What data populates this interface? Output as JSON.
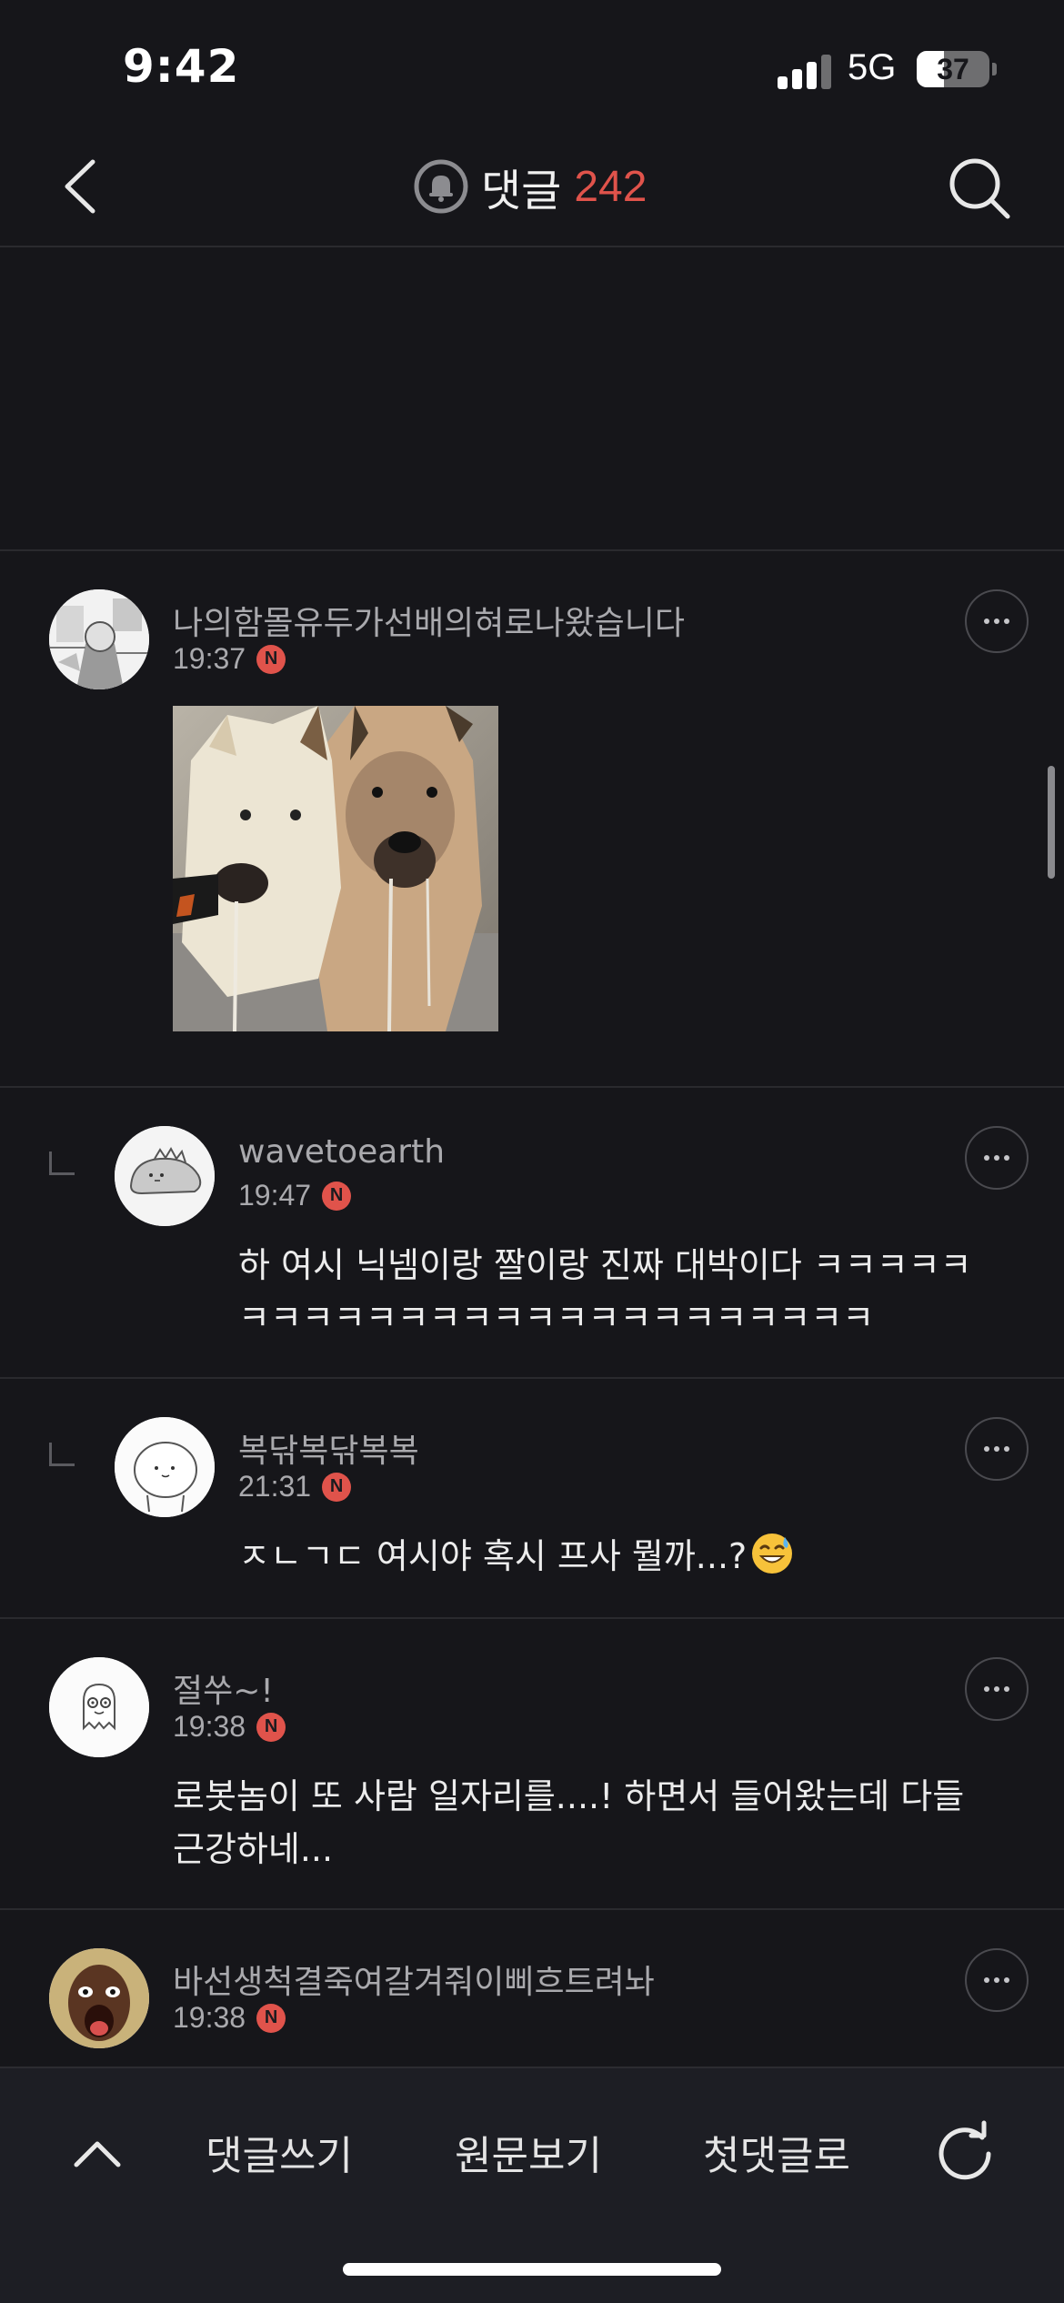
{
  "status_bar": {
    "time": "9:42",
    "network": "5G",
    "battery": "37",
    "battery_level": 0.37
  },
  "header": {
    "title": "댓글",
    "count": "242",
    "bell_icon": "bell-icon",
    "back_icon": "chevron-left-icon",
    "search_icon": "search-icon"
  },
  "comments": [
    {
      "nickname": "나의함몰유두가선배의혀로나왔습니다",
      "time": "19:37",
      "badge": "N",
      "text": "",
      "has_image": true
    },
    {
      "nickname": "wavetoearth",
      "time": "19:47",
      "badge": "N",
      "text_line1": "하 여시 닉넴이랑 짤이랑 진짜 대박이다 ㅋㅋㅋㅋㅋ",
      "text_line2": "ㅋㅋㅋㅋㅋㅋㅋㅋㅋㅋㅋㅋㅋㅋㅋㅋㅋㅋㅋㅋ",
      "is_reply": true
    },
    {
      "nickname": "복닦복닦복복",
      "time": "21:31",
      "badge": "N",
      "text": "ㅈㄴㄱㄷ 여시야 혹시 프사 뭘까...?",
      "emoji": "sweat-smile-emoji",
      "is_reply": true
    },
    {
      "nickname": "절쑤~!",
      "time": "19:38",
      "badge": "N",
      "text_line1": "로봇놈이 또 사람 일자리를....! 하면서 들어왔는데 다들",
      "text_line2": "근강하네..."
    },
    {
      "nickname": "바선생척결죽여갈겨줘이삐흐트려놔",
      "time": "19:38",
      "badge": "N"
    }
  ],
  "toolbar": {
    "up_icon": "chevron-up-icon",
    "write": "댓글쓰기",
    "original": "원문보기",
    "first": "첫댓글로",
    "refresh_icon": "refresh-icon"
  },
  "colors": {
    "background": "#16161a",
    "accent": "#e0534b",
    "toolbar": "#1d1e24"
  }
}
